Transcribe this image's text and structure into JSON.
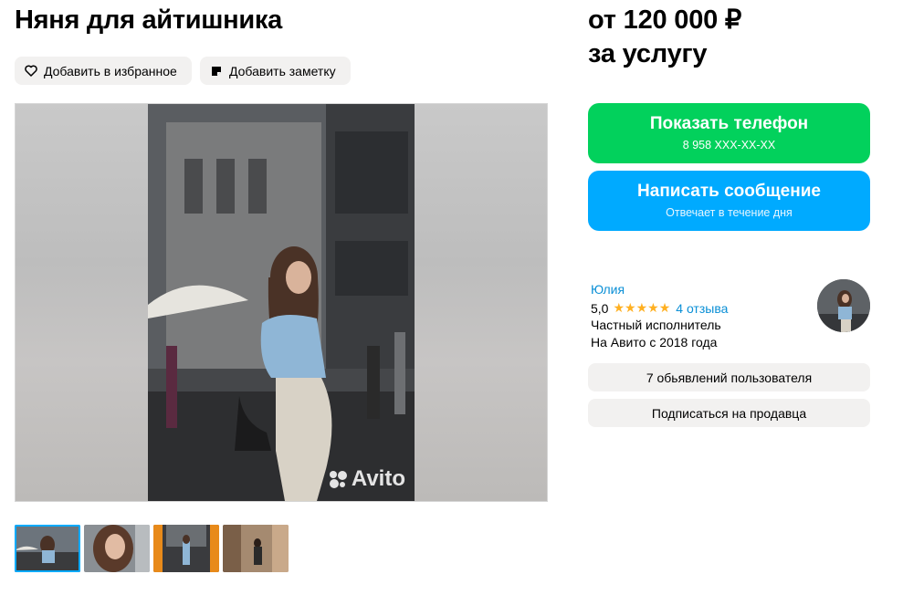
{
  "title": "Няня для айтишника",
  "actions": {
    "favorite_label": "Добавить в избранное",
    "note_label": "Добавить заметку"
  },
  "gallery": {
    "watermark": "Avito",
    "thumbnail_count": 4
  },
  "price": {
    "line1": "от 120 000 ₽",
    "line2": "за услугу"
  },
  "contact": {
    "phone_label": "Показать телефон",
    "phone_number": "8 958 XXX-XX-XX",
    "message_label": "Написать сообщение",
    "message_sub": "Отвечает в течение дня"
  },
  "seller": {
    "name": "Юлия",
    "rating": "5,0",
    "stars": 5,
    "reviews": "4 отзыва",
    "type": "Частный исполнитель",
    "since": "На Авито с 2018 года",
    "ads_button": "7 обьявлений пользователя",
    "subscribe_button": "Подписаться на продавца"
  },
  "colors": {
    "phone_button": "#02d15c",
    "message_button": "#00aaff",
    "link": "#0a8fd6",
    "star": "#ffb021",
    "chip_bg": "#f2f1f0"
  },
  "icons": [
    "heart-icon",
    "note-icon",
    "star-icon",
    "avito-logo-icon"
  ]
}
